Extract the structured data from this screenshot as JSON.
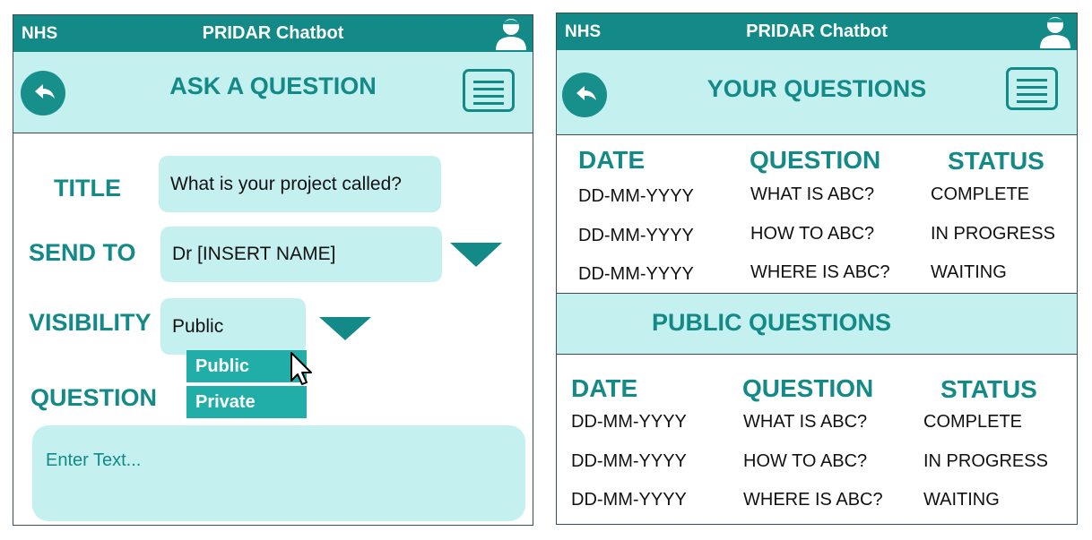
{
  "ask_screen": {
    "header": {
      "org": "NHS",
      "app_title": "PRIDAR Chatbot",
      "user_icon": "user-icon"
    },
    "banner": {
      "title": "ASK A QUESTION",
      "back_icon": "back-arrow-icon",
      "menu_icon": "hamburger-menu-icon"
    },
    "form": {
      "title_label": "TITLE",
      "title_value": "What is your project called?",
      "send_to_label": "SEND TO",
      "send_to_value": "Dr [INSERT NAME]",
      "visibility_label": "VISIBILITY",
      "visibility_value": "Public",
      "visibility_options": [
        "Public",
        "Private"
      ],
      "question_label": "QUESTION",
      "question_placeholder": "Enter Text..."
    }
  },
  "questions_screen": {
    "header": {
      "org": "NHS",
      "app_title": "PRIDAR Chatbot",
      "user_icon": "user-icon"
    },
    "banner": {
      "title": "YOUR QUESTIONS",
      "back_icon": "back-arrow-icon",
      "menu_icon": "hamburger-menu-icon"
    },
    "your_questions": {
      "columns": [
        "DATE",
        "QUESTION",
        "STATUS"
      ],
      "rows": [
        [
          "DD-MM-YYYY",
          "WHAT IS ABC?",
          "COMPLETE"
        ],
        [
          "DD-MM-YYYY",
          "HOW TO ABC?",
          "IN PROGRESS"
        ],
        [
          "DD-MM-YYYY",
          "WHERE IS ABC?",
          "WAITING"
        ]
      ]
    },
    "public_questions": {
      "title": "PUBLIC QUESTIONS",
      "columns": [
        "DATE",
        "QUESTION",
        "STATUS"
      ],
      "rows": [
        [
          "DD-MM-YYYY",
          "WHAT IS ABC?",
          "COMPLETE"
        ],
        [
          "DD-MM-YYYY",
          "HOW TO ABC?",
          "IN PROGRESS"
        ],
        [
          "DD-MM-YYYY",
          "WHERE IS ABC?",
          "WAITING"
        ]
      ]
    }
  },
  "colors": {
    "primary": "#138a87",
    "light": "#c4f0f0",
    "option": "#21aea9",
    "border": "#3d4d55"
  }
}
